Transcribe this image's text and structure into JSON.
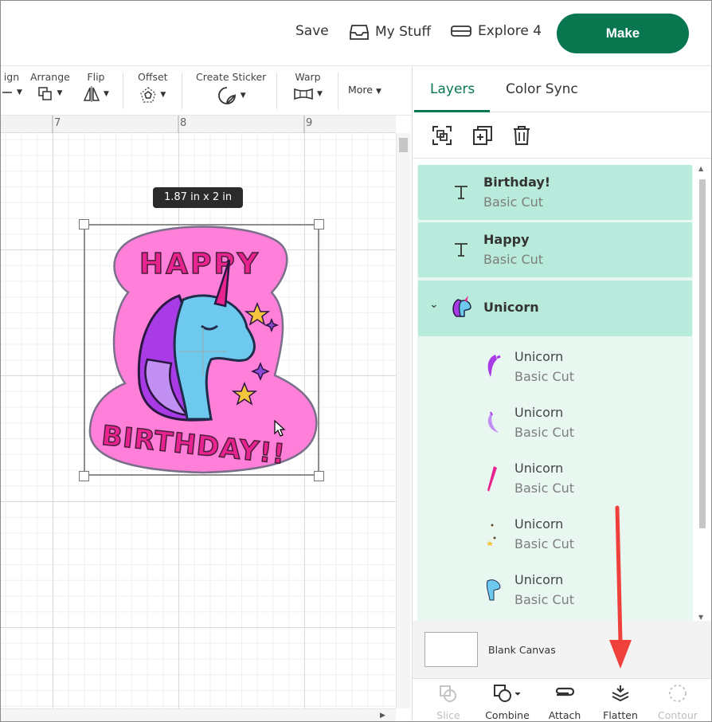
{
  "header": {
    "save_label": "Save",
    "mystuff_label": "My Stuff",
    "explore_label": "Explore 4",
    "make_label": "Make"
  },
  "toolbar": {
    "align_label": "ign",
    "arrange_label": "Arrange",
    "flip_label": "Flip",
    "offset_label": "Offset",
    "create_sticker_label": "Create Sticker",
    "warp_label": "Warp",
    "more_label": "More"
  },
  "canvas": {
    "ruler": [
      "7",
      "8",
      "9"
    ],
    "size_label": "1.87  in x 2  in"
  },
  "panel": {
    "tabs": [
      "Layers",
      "Color Sync"
    ],
    "layers": [
      {
        "title": "Birthday!",
        "sub": "Basic Cut"
      },
      {
        "title": "Happy",
        "sub": "Basic Cut"
      },
      {
        "title": "Unicorn"
      }
    ],
    "children": [
      {
        "title": "Unicorn",
        "sub": "Basic Cut"
      },
      {
        "title": "Unicorn",
        "sub": "Basic Cut"
      },
      {
        "title": "Unicorn",
        "sub": "Basic Cut"
      },
      {
        "title": "Unicorn",
        "sub": "Basic Cut"
      },
      {
        "title": "Unicorn",
        "sub": "Basic Cut"
      }
    ],
    "blank_canvas_label": "Blank Canvas",
    "bottom": {
      "slice": "Slice",
      "combine": "Combine",
      "attach": "Attach",
      "flatten": "Flatten",
      "contour": "Contour"
    }
  },
  "colors": {
    "brand_green": "#08774f",
    "layer_selected": "#b9ebdc",
    "layer_group_bg": "#e9f7f1",
    "arrow_red": "#f0403c"
  }
}
